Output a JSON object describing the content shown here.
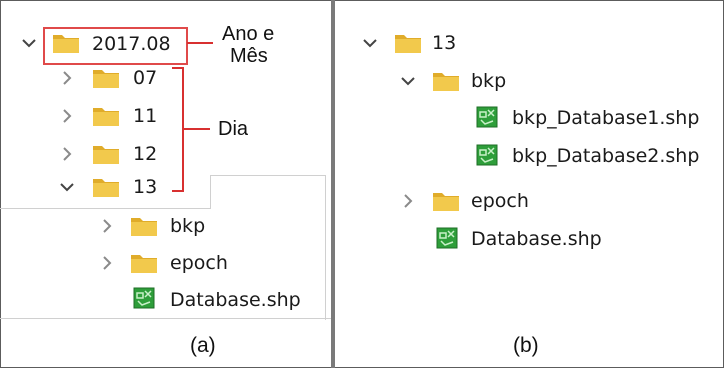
{
  "panel_a": {
    "caption": "(a)",
    "annotations": {
      "year_month_line1": "Ano e",
      "year_month_line2": "Mês",
      "day": "Dia"
    },
    "tree": [
      {
        "label": "2017.08",
        "type": "folder",
        "expanded": true,
        "highlighted": true
      },
      {
        "label": "07",
        "type": "folder",
        "expanded": false
      },
      {
        "label": "11",
        "type": "folder",
        "expanded": false
      },
      {
        "label": "12",
        "type": "folder",
        "expanded": false
      },
      {
        "label": "13",
        "type": "folder",
        "expanded": true
      },
      {
        "label": "bkp",
        "type": "folder",
        "expanded": false
      },
      {
        "label": "epoch",
        "type": "folder",
        "expanded": false
      },
      {
        "label": "Database.shp",
        "type": "shapefile"
      }
    ]
  },
  "panel_b": {
    "caption": "(b)",
    "tree": [
      {
        "label": "13",
        "type": "folder",
        "expanded": true
      },
      {
        "label": "bkp",
        "type": "folder",
        "expanded": true
      },
      {
        "label": "bkp_Database1.shp",
        "type": "shapefile"
      },
      {
        "label": "bkp_Database2.shp",
        "type": "shapefile"
      },
      {
        "label": "epoch",
        "type": "folder",
        "expanded": false
      },
      {
        "label": "Database.shp",
        "type": "shapefile"
      }
    ]
  },
  "icons": {
    "chevron_collapsed": "chevron-right-icon",
    "chevron_expanded": "chevron-down-icon",
    "folder": "folder-icon",
    "shapefile": "shapefile-icon"
  },
  "colors": {
    "folder_fill": "#f2c94c",
    "folder_tab": "#e0ac2a",
    "shapefile_green": "#2e9e3a",
    "annotation_red": "#d83030",
    "chevron_gray": "#8a8a8a",
    "chevron_dark": "#444444"
  }
}
